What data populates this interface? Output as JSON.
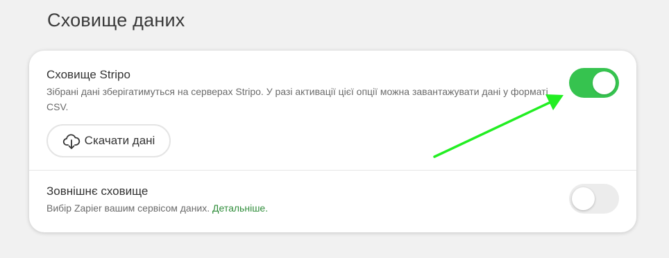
{
  "page": {
    "title": "Сховище даних"
  },
  "stripo_storage": {
    "title": "Сховище Stripo",
    "description": "Зібрані дані зберігатимуться на серверах Stripo. У разі активації цієї опції можна завантажувати дані у форматі CSV.",
    "toggle_on": true,
    "download_button_label": "Скачати дані",
    "download_icon": "cloud-download-icon"
  },
  "external_storage": {
    "title": "Зовнішнє сховище",
    "description": "Вибір Zapier вашим сервісом даних.",
    "link_text": "Детальніше.",
    "toggle_on": false
  },
  "annotation": {
    "arrow_color": "#22ee22"
  },
  "colors": {
    "accent_green": "#36c34f",
    "link_green": "#2f8d3a",
    "toggle_off": "#ececec"
  }
}
